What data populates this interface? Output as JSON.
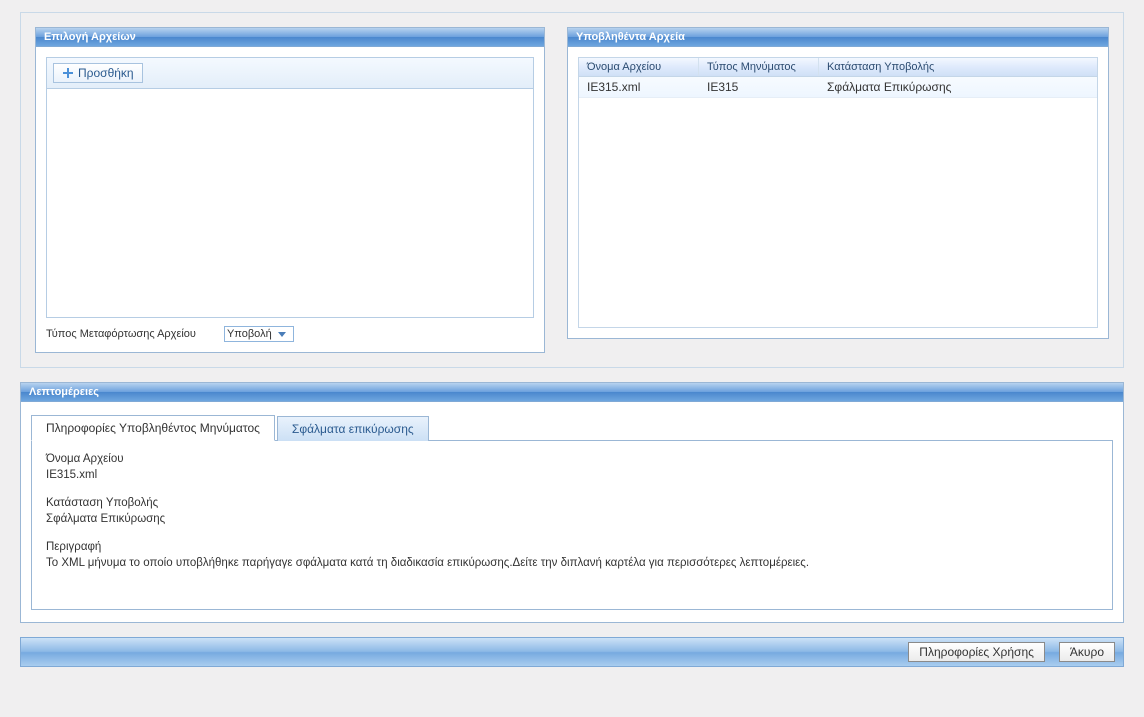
{
  "file_selection": {
    "title": "Επιλογή Αρχείων",
    "add_button": "Προσθήκη",
    "upload_type_label": "Τύπος Μεταφόρτωσης Αρχείου",
    "upload_type_value": "Υποβολή"
  },
  "submitted_files": {
    "title": "Υποβληθέντα Αρχεία",
    "columns": {
      "filename": "Όνομα Αρχείου",
      "message_type": "Τύπος Μηνύματος",
      "status": "Κατάσταση Υποβολής"
    },
    "rows": [
      {
        "filename": "IE315.xml",
        "message_type": "IE315",
        "status": "Σφάλματα Επικύρωσης"
      }
    ]
  },
  "details": {
    "title": "Λεπτομέρειες",
    "tabs": {
      "info": "Πληροφορίες Υποβληθέντος Μηνύματος",
      "errors": "Σφάλματα επικύρωσης"
    },
    "filename_label": "Όνομα Αρχείου",
    "filename_value": "IE315.xml",
    "status_label": "Κατάσταση Υποβολής",
    "status_value": "Σφάλματα Επικύρωσης",
    "description_label": "Περιγραφή",
    "description_value": "Το XML μήνυμα το οποίο υποβλήθηκε παρήγαγε σφάλματα κατά τη διαδικασία επικύρωσης.Δείτε την διπλανή καρτέλα για περισσότερες λεπτομέρειες."
  },
  "bottom_bar": {
    "usage_info": "Πληροφορίες Χρήσης",
    "cancel": "Άκυρο"
  }
}
